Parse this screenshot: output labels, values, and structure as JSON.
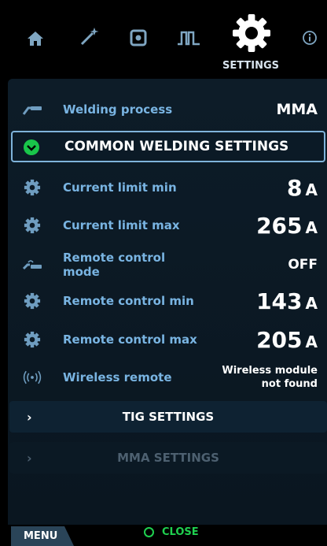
{
  "nav": {
    "icons": [
      "home-icon",
      "wand-icon",
      "record-icon",
      "pulse-icon",
      "gear-icon",
      "info-icon"
    ],
    "active_label": "SETTINGS"
  },
  "process": {
    "label": "Welding process",
    "value": "MMA"
  },
  "common": {
    "title": "COMMON WELDING SETTINGS"
  },
  "settings": {
    "current_min": {
      "label": "Current limit min",
      "value": "8",
      "unit": "A"
    },
    "current_max": {
      "label": "Current limit max",
      "value": "265",
      "unit": "A"
    },
    "remote_mode": {
      "label_line1": "Remote control",
      "label_line2": "mode",
      "value": "OFF"
    },
    "remote_min": {
      "label": "Remote control min",
      "value": "143",
      "unit": "A"
    },
    "remote_max": {
      "label": "Remote control max",
      "value": "205",
      "unit": "A"
    },
    "wireless": {
      "label": "Wireless remote",
      "value_line1": "Wireless module",
      "value_line2": "not found"
    }
  },
  "sections": {
    "tig": "TIG SETTINGS",
    "mma": "MMA SETTINGS"
  },
  "footer": {
    "menu": "MENU",
    "close": "CLOSE"
  },
  "colors": {
    "accent": "#79b4e2",
    "ok": "#19c54a",
    "background": "#000000"
  }
}
